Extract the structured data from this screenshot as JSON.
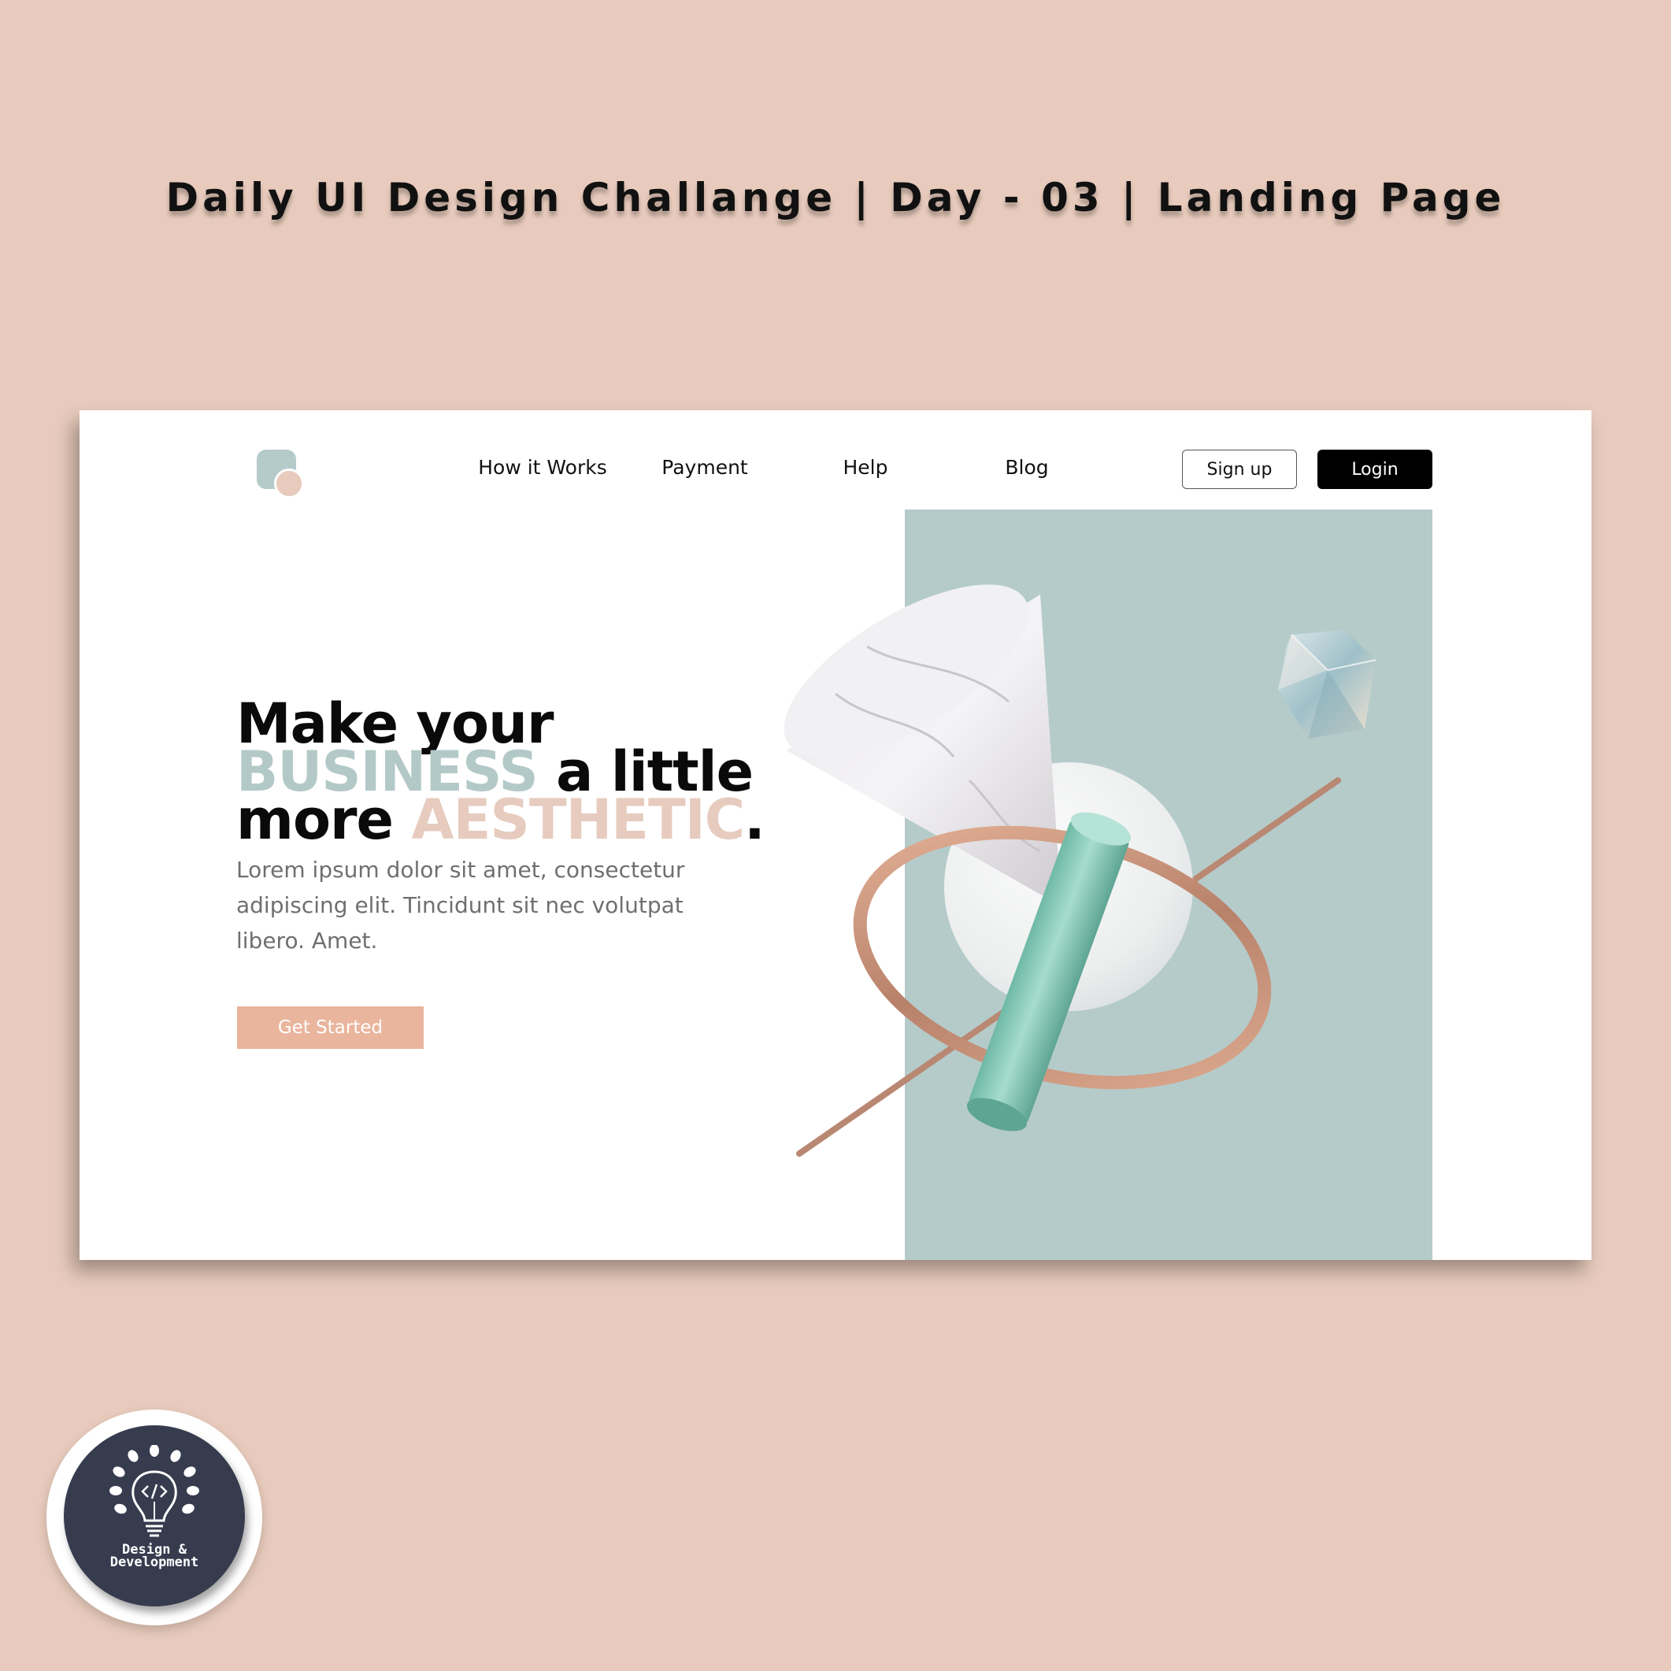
{
  "page_title": "Daily UI Design Challange | Day - 03 | Landing Page",
  "colors": {
    "page_background": "#e8cbbc",
    "accent_teal": "#b5cbca",
    "accent_peach": "#e6cbbe",
    "button_peach": "#e9b59c",
    "badge_navy": "#363b4e"
  },
  "landing": {
    "logo": "logo-icon",
    "nav": {
      "how_it_works": "How it Works",
      "payment": "Payment",
      "help": "Help",
      "blog": "Blog"
    },
    "signup_label": "Sign up",
    "login_label": "Login",
    "headline": {
      "w1": "Make your",
      "w2": "BUSINESS",
      "w3": "a little",
      "w4": "more",
      "w5": "AESTHETIC",
      "w6": "."
    },
    "body": "Lorem ipsum dolor sit amet, consectetur adipiscing elit. Tincidunt sit nec volutpat libero. Amet.",
    "cta_label": "Get Started"
  },
  "badge": {
    "icon": "lightbulb-code-icon",
    "line1": "Design &",
    "line2": "Development"
  }
}
